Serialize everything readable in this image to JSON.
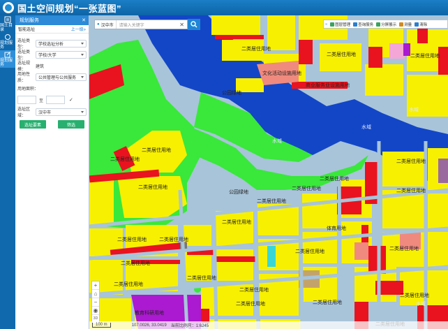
{
  "app": {
    "title": "国土空间规划“一张蓝图”"
  },
  "rail": [
    {
      "label": "国土目录",
      "icon": "list-icon"
    },
    {
      "label": "规划服务",
      "icon": "refresh-icon"
    },
    {
      "label": "规划服务",
      "icon": "edit-icon"
    }
  ],
  "panel": {
    "title": "规划服务",
    "subtitle": "智能选址",
    "back_link": "上一级»",
    "fields": [
      {
        "label": "选址类型：",
        "value": "学校选址分析"
      },
      {
        "label": "选址类型：",
        "value": "学校/大学"
      },
      {
        "label": "选址规模：",
        "value": "建筑"
      },
      {
        "label": "用地性质：",
        "value": "公共管理与公共服务"
      }
    ],
    "area_label": "用地面积：",
    "range_sep": "至",
    "region_label": "选址区域：",
    "region_value": "汉中市",
    "btn_select": "选址要素",
    "btn_filter": "筛选"
  },
  "search": {
    "city": "汉中市",
    "placeholder": "请输入关键字"
  },
  "toolbar": [
    {
      "label": "图层管理",
      "color": "#3aa35c"
    },
    {
      "label": "查询服务",
      "color": "#2a7fd0"
    },
    {
      "label": "分屏展示",
      "color": "#3aa35c"
    },
    {
      "label": "测量",
      "color": "#d28a20"
    },
    {
      "label": "清除",
      "color": "#2a7fd0"
    }
  ],
  "map": {
    "labels": {
      "residential": "二类居住用地",
      "water": "水域",
      "park": "公园绿地",
      "culture": "文化活动设施用地",
      "commerce": "商业服务业设施用地",
      "sports": "体育用地",
      "edu": "教育科研用地"
    },
    "colors": {
      "residential": "#f7f000",
      "commercial": "#e8131f",
      "water": "#1346c7",
      "park": "#39e83a",
      "road": "#a8c4d9",
      "culture": "#f08a7e",
      "edu": "#ab19d0"
    }
  },
  "zoom": [
    "+",
    "−"
  ],
  "status": {
    "scale": "100 m",
    "coords": "107.0026, 33.0419",
    "hint": "当前比例尺：1:6245"
  }
}
